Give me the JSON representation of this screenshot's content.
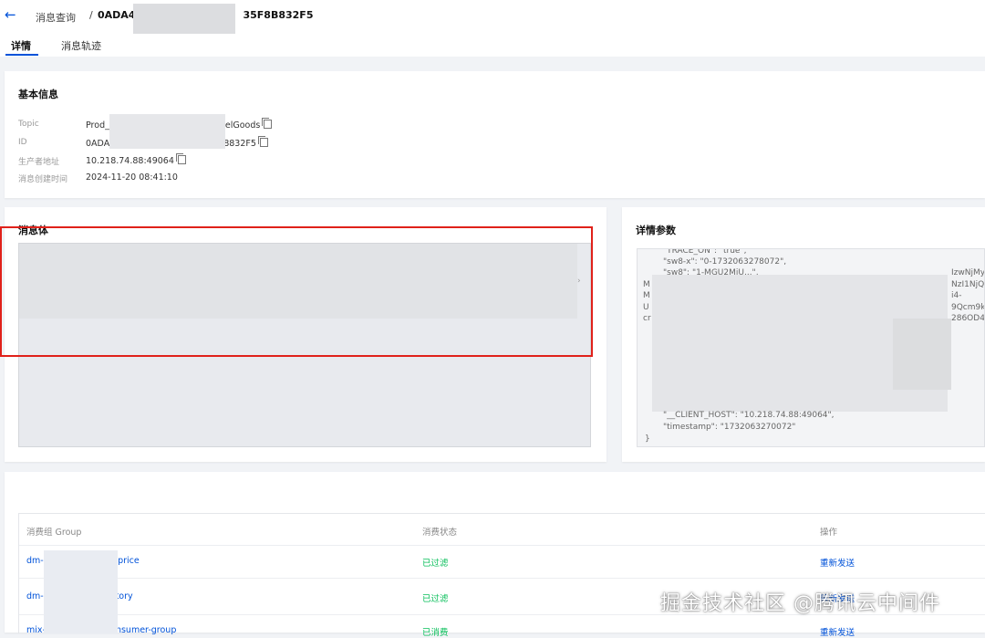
{
  "header": {
    "back_icon": "arrow-left-icon",
    "breadcrumb_parent": "消息查询",
    "breadcrumb_separator": "/",
    "message_id_prefix": "0ADA4/",
    "message_id_suffix": "35F8B832F5"
  },
  "tabs": [
    {
      "label": "详情",
      "active": true
    },
    {
      "label": "消息轨迹",
      "active": false
    }
  ],
  "basic_info": {
    "title": "基本信息",
    "rows": [
      {
        "key": "Topic",
        "value_prefix": "Prod_",
        "value_suffix": "nelGoods"
      },
      {
        "key": "ID",
        "value_prefix": "0ADA",
        "value_suffix": "8832F5"
      },
      {
        "key": "生产者地址",
        "value_prefix": "10.218.74.88:49064",
        "value_suffix": ""
      },
      {
        "key": "消息创建时间",
        "value_prefix": "2024-11-20 08:41:10",
        "value_suffix": ""
      }
    ]
  },
  "message_body": {
    "title": "消息体",
    "scroll_marker": "›"
  },
  "detail_params": {
    "title": "详情参数",
    "lines": [
      "\"TRACE_ON\": \"true\",",
      "\"sw8-x\": \"0-1732063278072\",",
      "\"sw8\": \"1-MGU2MjU...\",",
      "\"__CLIENT_HOST\": \"10.218.74.88:49064\",",
      "\"timestamp\": \"1732063270072\"",
      "}"
    ],
    "fragments_left": [
      "M",
      "M",
      "U",
      "cr"
    ],
    "fragments_right": [
      "IzwNjMy",
      "NzI1NjQ",
      "i4-",
      "9Qcm9k",
      "286OD4"
    ]
  },
  "consume_table": {
    "columns": [
      "消费组 Group",
      "消费状态",
      "操作"
    ],
    "rows": [
      {
        "group_prefix": "dm-",
        "group_suffix": "ill-price",
        "status": "已过滤",
        "action": "重新发送"
      },
      {
        "group_prefix": "dm-",
        "group_suffix": "entory",
        "status": "已过滤",
        "action": "重新发送"
      },
      {
        "group_prefix": "mix-",
        "group_suffix": "nsumer-group",
        "status": "已消费",
        "action": "重新发送"
      }
    ]
  },
  "watermark": "掘金技术社区 @腾讯云中间件",
  "colors": {
    "accent": "#0052d9",
    "success": "#0abf5b",
    "highlight_border": "#e0211a"
  }
}
